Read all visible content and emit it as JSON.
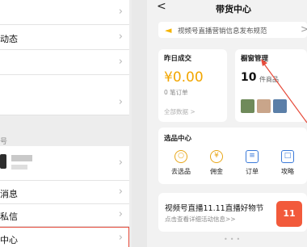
{
  "left": {
    "rows": [
      {
        "label": ""
      },
      {
        "label": "动态"
      },
      {
        "label": ""
      },
      {
        "label": ""
      }
    ],
    "section_label": "号",
    "rows2": [
      {
        "label": "消息"
      },
      {
        "label": "私信"
      },
      {
        "label": "中心"
      }
    ]
  },
  "header": {
    "back": "<",
    "title": "带货中心"
  },
  "notice": {
    "text": "视频号直播营销信息发布规范",
    "chevron": ">"
  },
  "sales": {
    "title": "昨日成交",
    "amount": "¥0.00",
    "orders": "0 笔订单",
    "all_data": "全部数据 >"
  },
  "window": {
    "title": "橱窗管理",
    "count": "10",
    "unit": "件商品"
  },
  "select_center": {
    "title": "选品中心",
    "tools": [
      {
        "label": "去选品",
        "icon": "selection-icon"
      },
      {
        "label": "佣金",
        "icon": "commission-icon"
      },
      {
        "label": "订单",
        "icon": "order-icon"
      },
      {
        "label": "攻略",
        "icon": "guide-icon"
      }
    ]
  },
  "promo": {
    "title": "视频号直播11.11直播好物节",
    "subtitle": "点击查看详细活动信息>>",
    "logo_text": "11"
  },
  "colors": {
    "accent": "#f2a600",
    "highlight": "#e64a3a"
  }
}
